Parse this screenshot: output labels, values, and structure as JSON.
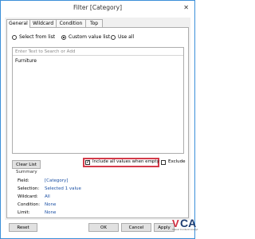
{
  "dialog": {
    "title": "Filter [Category]"
  },
  "tabs": [
    {
      "label": "General",
      "active": true
    },
    {
      "label": "Wildcard",
      "active": false
    },
    {
      "label": "Condition",
      "active": false
    },
    {
      "label": "Top",
      "active": false
    }
  ],
  "selection_mode": {
    "options": [
      "Select from list",
      "Custom value list",
      "Use all"
    ],
    "selected": "Custom value list"
  },
  "custom_list": {
    "placeholder": "Enter Text to Search or Add",
    "items": [
      "Furniture"
    ]
  },
  "buttons": {
    "clear_list": "Clear List",
    "reset": "Reset",
    "ok": "OK",
    "cancel": "Cancel",
    "apply": "Apply"
  },
  "options": {
    "include_all_when_empty": {
      "label": "Include all values when empty",
      "checked": true
    },
    "exclude": {
      "label": "Exclude",
      "checked": false
    }
  },
  "summary": {
    "heading": "Summary",
    "rows": [
      {
        "key": "Field:",
        "value": "[Category]"
      },
      {
        "key": "Selection:",
        "value": "Selected 1 value"
      },
      {
        "key": "Wildcard:",
        "value": "All"
      },
      {
        "key": "Condition:",
        "value": "None"
      },
      {
        "key": "Limit:",
        "value": "None"
      }
    ]
  },
  "colors": {
    "accent_border": "#3c8fd9",
    "highlight": "#d33b4a",
    "summary_value": "#1a4fa3"
  },
  "watermark": {
    "logo_text": "VCA",
    "subtext": "Visual Content Analyt"
  }
}
